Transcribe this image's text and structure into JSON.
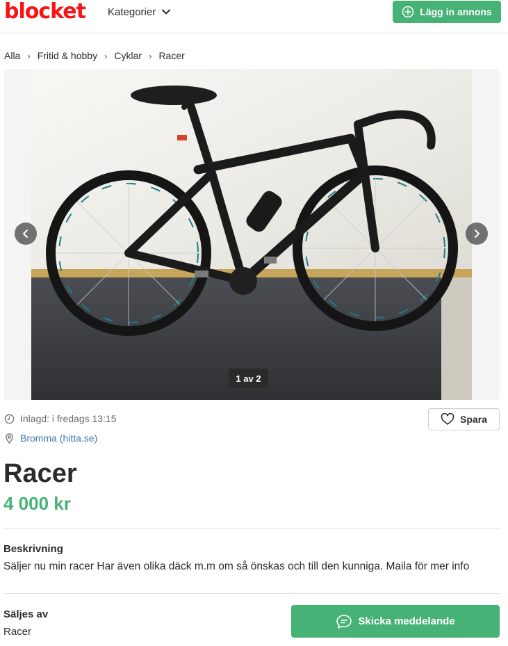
{
  "header": {
    "logo": "blocket",
    "categories_label": "Kategorier",
    "post_ad_label": "Lägg in annons"
  },
  "breadcrumb": [
    "Alla",
    "Fritid & hobby",
    "Cyklar",
    "Racer"
  ],
  "gallery": {
    "counter": "1 av 2",
    "photo_icon": "bicycle-photo"
  },
  "meta": {
    "posted": "Inlagd: i fredags 13:15",
    "location": "Bromma (hitta.se)"
  },
  "save_label": "Spara",
  "ad": {
    "title": "Racer",
    "price": "4 000 kr"
  },
  "description": {
    "heading": "Beskrivning",
    "text": "Säljer nu min racer Har även olika däck m.m om så önskas och till den kunniga. Maila för mer info"
  },
  "seller": {
    "heading": "Säljes av",
    "name": "Racer"
  },
  "message_button_label": "Skicka meddelande",
  "colors": {
    "brand_red": "#f71414",
    "accent_green": "#47b275",
    "link_blue": "#3a7ab8"
  }
}
